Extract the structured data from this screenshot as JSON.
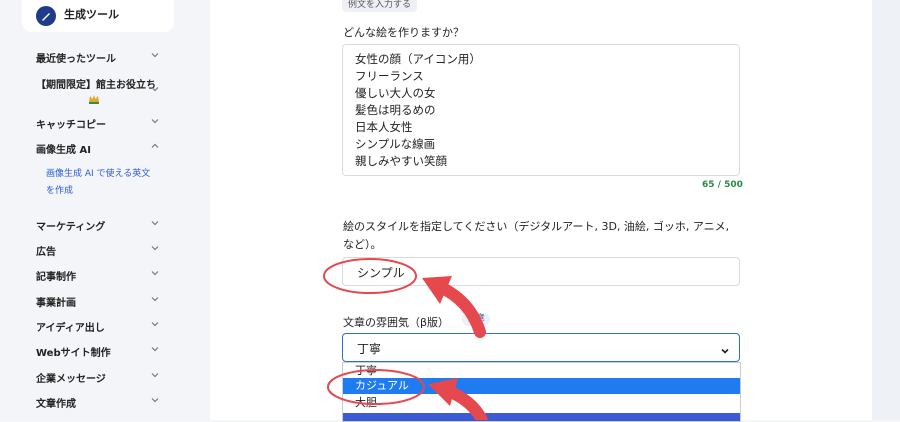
{
  "sidebar": {
    "tool_name": "生成ツール",
    "items": [
      {
        "label": "最近使ったツール"
      },
      {
        "label": "【期間限定】館主お役立ち"
      },
      {
        "label": "キャッチコピー"
      },
      {
        "label": "画像生成 AI"
      },
      {
        "label": "マーケティング"
      },
      {
        "label": "広告"
      },
      {
        "label": "記事制作"
      },
      {
        "label": "事業計画"
      },
      {
        "label": "アイディア出し"
      },
      {
        "label": "Webサイト制作"
      },
      {
        "label": "企業メッセージ"
      },
      {
        "label": "文章作成"
      }
    ],
    "sub_item_line1": "画像生成 AI で使える英文",
    "sub_item_line2": "を作成"
  },
  "form": {
    "top_chip": "例文を入力する",
    "question_label": "どんな絵を作りますか？",
    "textarea_lines": [
      "女性の顔（アイコン用）",
      "フリーランス",
      "優しい大人の女",
      "髪色は明るめの",
      "日本人女性",
      "シンプルな線画",
      "親しみやすい笑顔"
    ],
    "counter": "65 / 500",
    "style_label": "絵のスタイルを指定してください（デジタルアート, 3D, 油絵, ゴッホ, アニメ, など）。",
    "style_value": "シンプル",
    "mood_label": "文章の雰囲気（β版）",
    "mood_badge": "任意",
    "mood_value": "丁寧",
    "options": [
      "丁寧",
      "カジュアル",
      "大胆"
    ]
  },
  "colors": {
    "accent": "#2f6fcf",
    "selected_option": "#1e7bf0",
    "annotation": "#e5484d",
    "counter": "#2a8a4a"
  }
}
